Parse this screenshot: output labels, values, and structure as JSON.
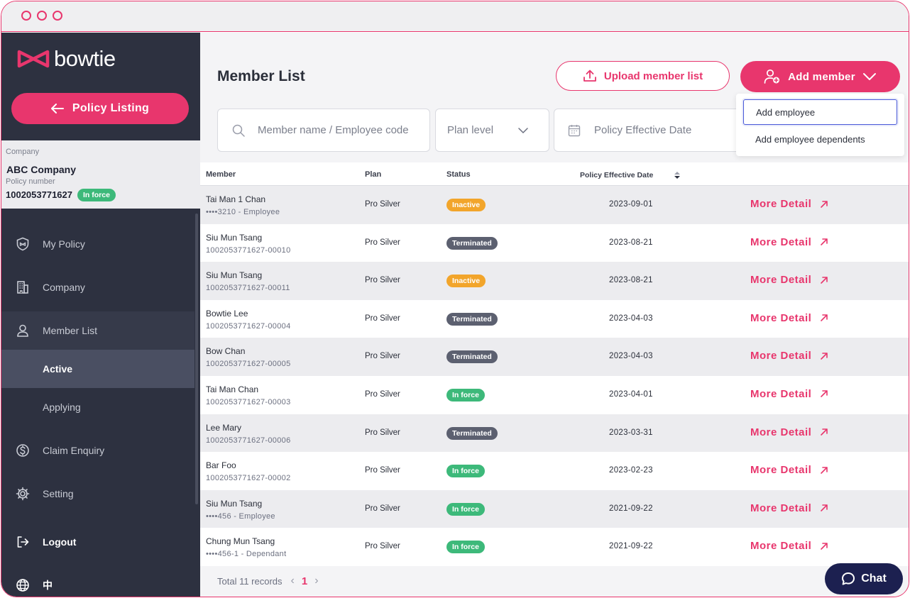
{
  "brand": {
    "name": "bowtie",
    "accent": "#e8366d",
    "sidebar_bg": "#2d3140",
    "chat_bg": "#1c2050"
  },
  "sidebar": {
    "policy_listing_label": "Policy Listing",
    "company_label": "Company",
    "company_name": "ABC Company",
    "policy_number_label": "Policy number",
    "policy_number": "1002053771627",
    "policy_status": "In force",
    "nav": [
      {
        "label": "My Policy",
        "icon": "shield-icon"
      },
      {
        "label": "Company",
        "icon": "building-icon"
      },
      {
        "label": "Member List",
        "icon": "user-icon"
      },
      {
        "label": "Active",
        "icon": ""
      },
      {
        "label": "Applying",
        "icon": ""
      },
      {
        "label": "Claim Enquiry",
        "icon": "dollar-icon"
      },
      {
        "label": "Setting",
        "icon": "gear-icon"
      },
      {
        "label": "Logout",
        "icon": "logout-icon"
      },
      {
        "label": "中",
        "icon": "globe-icon"
      }
    ]
  },
  "header": {
    "title": "Member List",
    "upload_label": "Upload member list",
    "add_member_label": "Add member"
  },
  "add_menu": {
    "items": [
      "Add employee",
      "Add employee dependents"
    ]
  },
  "filters": {
    "search_placeholder": "Member name / Employee code",
    "plan_level": "Plan level",
    "effective_date": "Policy Effective Date"
  },
  "table": {
    "columns": [
      "Member",
      "Plan",
      "Status",
      "Policy Effective Date"
    ],
    "more_label": "More Detail",
    "rows": [
      {
        "name": "Tai Man 1 Chan",
        "sub": "••••3210 - Employee",
        "plan": "Pro Silver",
        "status": "Inactive",
        "date": "2023-09-01"
      },
      {
        "name": "Siu Mun Tsang",
        "sub": "1002053771627-00010",
        "plan": "Pro Silver",
        "status": "Terminated",
        "date": "2023-08-21"
      },
      {
        "name": "Siu Mun Tsang",
        "sub": "1002053771627-00011",
        "plan": "Pro Silver",
        "status": "Inactive",
        "date": "2023-08-21"
      },
      {
        "name": "Bowtie Lee",
        "sub": "1002053771627-00004",
        "plan": "Pro Silver",
        "status": "Terminated",
        "date": "2023-04-03"
      },
      {
        "name": "Bow Chan",
        "sub": "1002053771627-00005",
        "plan": "Pro Silver",
        "status": "Terminated",
        "date": "2023-04-03"
      },
      {
        "name": "Tai Man Chan",
        "sub": "1002053771627-00003",
        "plan": "Pro Silver",
        "status": "In force",
        "date": "2023-04-01"
      },
      {
        "name": "Lee Mary",
        "sub": "1002053771627-00006",
        "plan": "Pro Silver",
        "status": "Terminated",
        "date": "2023-03-31"
      },
      {
        "name": "Bar Foo",
        "sub": "1002053771627-00002",
        "plan": "Pro Silver",
        "status": "In force",
        "date": "2023-02-23"
      },
      {
        "name": "Siu Mun Tsang",
        "sub": "••••456 - Employee",
        "plan": "Pro Silver",
        "status": "In force",
        "date": "2021-09-22"
      },
      {
        "name": "Chung Mun Tsang",
        "sub": "••••456-1 - Dependant",
        "plan": "Pro Silver",
        "status": "In force",
        "date": "2021-09-22"
      }
    ]
  },
  "footer": {
    "total": "Total 11 records",
    "page": "1"
  },
  "chat": {
    "label": "Chat"
  }
}
